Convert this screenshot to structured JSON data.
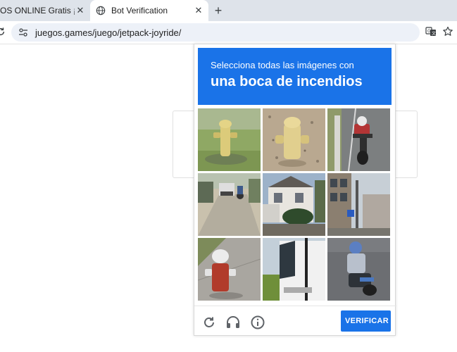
{
  "tabs": [
    {
      "title": "OS ONLINE Gratis ¡Juegos",
      "active": false
    },
    {
      "title": "Bot Verification",
      "active": true
    }
  ],
  "toolbar": {
    "url": "juegos.games/juego/jetpack-joyride/"
  },
  "captcha": {
    "instruction": "Selecciona todas las imágenes con",
    "target": "una boca de incendios",
    "verify_label": "VERIFICAR",
    "accent": "#1a73e8",
    "tiles": [
      {
        "content": "yellow fire hydrant on grass"
      },
      {
        "content": "yellow fire hydrant on gravel"
      },
      {
        "content": "motorcyclist on road"
      },
      {
        "content": "street with vehicles"
      },
      {
        "content": "house with bushes"
      },
      {
        "content": "buildings and street"
      },
      {
        "content": "red fire hydrant on sidewalk"
      },
      {
        "content": "truck on road"
      },
      {
        "content": "person on scooter"
      }
    ],
    "footer_icons": [
      "reload-icon",
      "audio-icon",
      "info-icon"
    ]
  }
}
